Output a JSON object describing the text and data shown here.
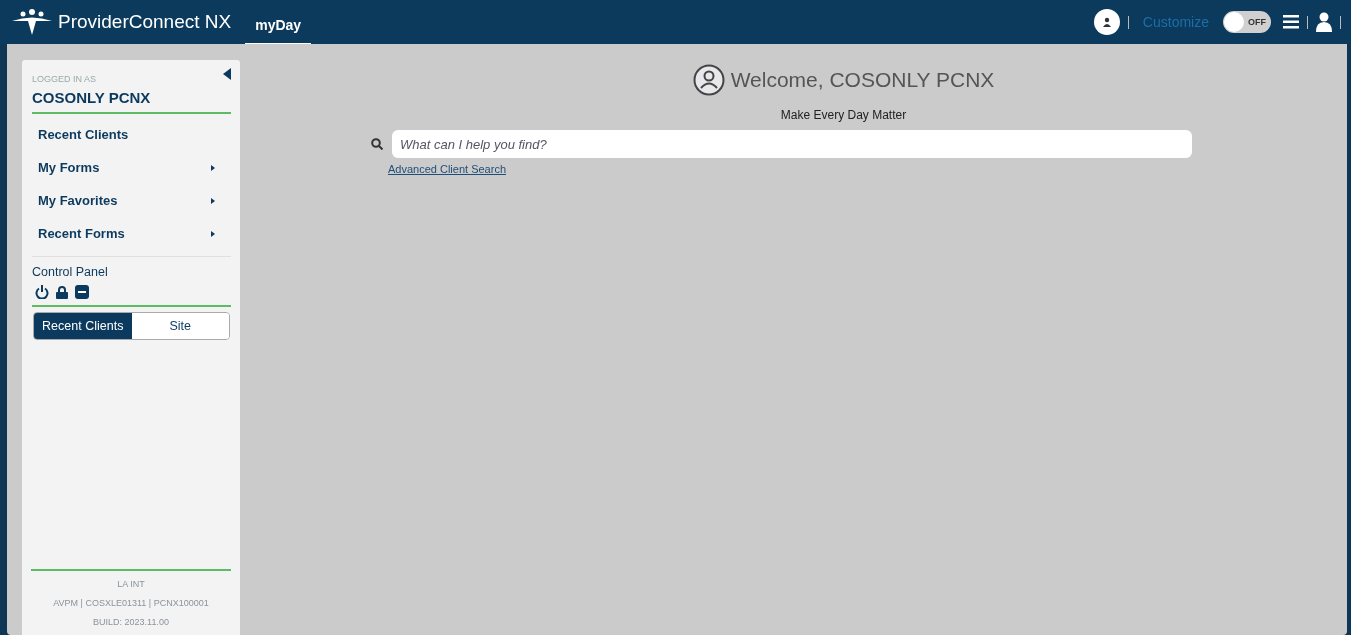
{
  "header": {
    "app_name": "ProviderConnect NX",
    "tabs": [
      {
        "label": "myDay",
        "selected": true
      }
    ],
    "customize": "Customize",
    "toggle": {
      "on": false,
      "label": "OFF"
    }
  },
  "sidebar": {
    "logged_in_label": "LOGGED IN AS",
    "user": "COSONLY PCNX",
    "items": [
      {
        "label": "Recent Clients",
        "expandable": false
      },
      {
        "label": "My Forms",
        "expandable": true
      },
      {
        "label": "My Favorites",
        "expandable": true
      },
      {
        "label": "Recent Forms",
        "expandable": true
      }
    ],
    "control_panel": "Control Panel",
    "segments": [
      {
        "label": "Recent Clients",
        "selected": true
      },
      {
        "label": "Site",
        "selected": false
      }
    ],
    "footer": [
      "LA INT",
      "AVPM | COSXLE01311 | PCNX100001",
      "BUILD: 2023.11.00"
    ]
  },
  "main": {
    "welcome": "Welcome, COSONLY PCNX",
    "tagline": "Make Every Day Matter",
    "search": {
      "placeholder": "What can I help you find?"
    },
    "link": "Advanced Client Search"
  }
}
